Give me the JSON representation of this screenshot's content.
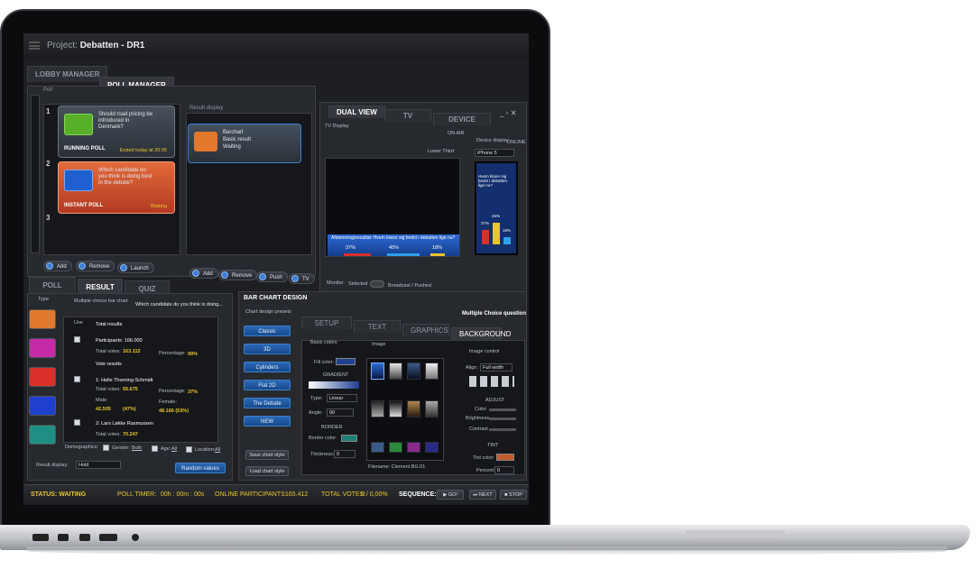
{
  "window": {
    "project_label": "Project:",
    "project_name": "Debatten - DR1"
  },
  "top_tabs": [
    "LOBBY MANAGER",
    "POLL MANAGER"
  ],
  "poll": {
    "header": "Poll",
    "result_display_header": "Result display",
    "rows": [
      "1",
      "2",
      "3"
    ],
    "cards": [
      {
        "question": "Should road pricing be introduced in Denmark?",
        "status": "RUNNING POLL",
        "meta": "Ended today at 20:05"
      },
      {
        "question": "Which candidate do you think is doing best in the debate?",
        "status": "INSTANT POLL",
        "meta": "Waiting"
      }
    ],
    "result_card": {
      "line1": "Barchart",
      "line2": "Basic result",
      "line3": "Waiting"
    },
    "buttons_left": [
      "Add",
      "Remove",
      "Launch"
    ],
    "buttons_right": [
      "Add",
      "Remove",
      "Push",
      "TV"
    ]
  },
  "dual": {
    "tabs": [
      "Dual View",
      "TV",
      "Device"
    ],
    "tv_display": "TV Display",
    "on_air": "ON AIR",
    "device_display": "Device display",
    "online": "ONLINE",
    "lower_third": "Lower Third",
    "device": "iPhone 5",
    "lower_text": "Afstemningsresultat: Hvem klarer sig bedst i debatten lige nu?",
    "pct": [
      "37%",
      "45%",
      "18%"
    ],
    "monitor": "Monitor:",
    "selected": "Selected",
    "broadcast": "Broadcast / Pushed",
    "phone_q": "Hvem klarer sig bedst i debatten lige nu?",
    "phone_pct": [
      "37%",
      "45%",
      "18%"
    ]
  },
  "result_tabs": [
    "POLL",
    "RESULT",
    "QUIZ"
  ],
  "result": {
    "type": "Type",
    "chart": "Multiple choice bar chart",
    "question": "Which candidate do you think is doing...",
    "use": "Use",
    "total_results": "Total results",
    "participants": "Participants: 166.000",
    "total_votes_l": "Total votes:",
    "total_votes": "163.112",
    "pct_l": "Percentage:",
    "pct": "99%",
    "vote_results": "Vote results",
    "c1": "1: Helle Thorning-Schmidt",
    "c1_votes": "55.675",
    "c1_pct": "37%",
    "male": "Male:",
    "male_v": "42.505",
    "male_p": "(47%)",
    "female": "Female:",
    "female_v": "48.166 (53%)",
    "c2": "2: Lars Løkke Rasmussen",
    "c2_votes": "70.247",
    "demographics": "Demographics:",
    "gender": "Gender:",
    "gender_v": "Both",
    "age": "Age:",
    "age_v": "All",
    "location": "Location:",
    "location_v": "All",
    "result_display": "Result display:",
    "hold": "Hold",
    "random": "Random values"
  },
  "design": {
    "title": "BAR CHART DESIGN",
    "mcq": "Multiple Choice question",
    "presets_label": "Chart design presets",
    "presets": [
      "Classic",
      "3D",
      "Cylinders",
      "Flat 2D",
      "The Debate",
      "NEW"
    ],
    "save": "Save chart style",
    "load": "Load chart style",
    "tabs": [
      "Setup",
      "Text",
      "Graphics",
      "Background"
    ],
    "basic_colors": "Basic colors",
    "image": "Image",
    "fill_color": "Fill color:",
    "gradient": "GRADIENT",
    "type": "Type:",
    "type_v": "Linear",
    "angle": "Angle:",
    "angle_v": "90",
    "border": "BORDER",
    "border_color": "Border color:",
    "thickness": "Thickness:",
    "thickness_v": "0",
    "image_control": "Image control",
    "align": "Align:",
    "align_v": "Full width",
    "adjust": "ADJUST",
    "color": "Color",
    "brightness": "Brightness",
    "contrast": "Contrast",
    "tint": "TINT",
    "tint_color": "Tint color:",
    "percent": "Percent:",
    "percent_v": "0",
    "filename": "Filename: Clement.BG.01"
  },
  "status": {
    "status": "STATUS: WAITING",
    "timer_l": "POLL TIMER:",
    "timer": "00h : 00m : 00s",
    "online_l": "ONLINE PARTICIPANTS:",
    "online": "165.412",
    "votes_l": "TOTAL VOTES:",
    "votes": "0 / 0,00%",
    "sequence": "SEQUENCE:",
    "go": "GO!",
    "next": "NEXT",
    "stop": "STOP"
  },
  "colors": {
    "accent": "#2a67b6",
    "yellow": "#e9c62c",
    "red": "#d9302a",
    "green": "#6ab62a",
    "orange": "#e2782c"
  }
}
